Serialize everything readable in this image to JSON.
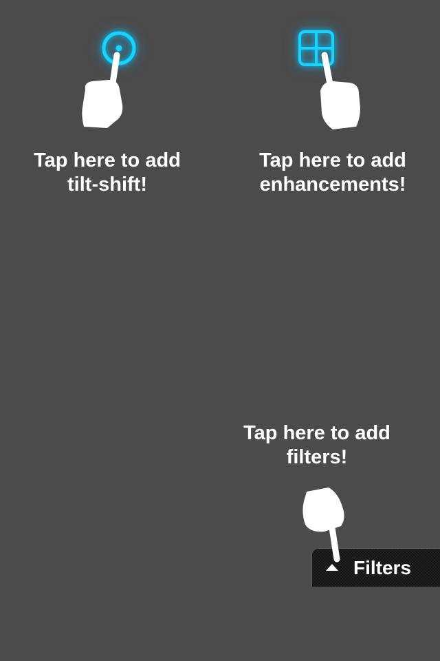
{
  "hints": {
    "tilt_shift": {
      "line1": "Tap here to add",
      "line2": "tilt-shift!",
      "icon": "tilt-shift-target-icon"
    },
    "enhancements": {
      "line1": "Tap here to add",
      "line2": "enhancements!",
      "icon": "enhancements-grid-icon"
    },
    "filters": {
      "line1": "Tap here to add",
      "line2": "filters!"
    }
  },
  "filters_button": {
    "label": "Filters",
    "icon": "caret-up-icon"
  },
  "colors": {
    "background": "#4b4b4b",
    "accent": "#00c8ff",
    "text": "#ffffff",
    "button_background": "#141414"
  }
}
